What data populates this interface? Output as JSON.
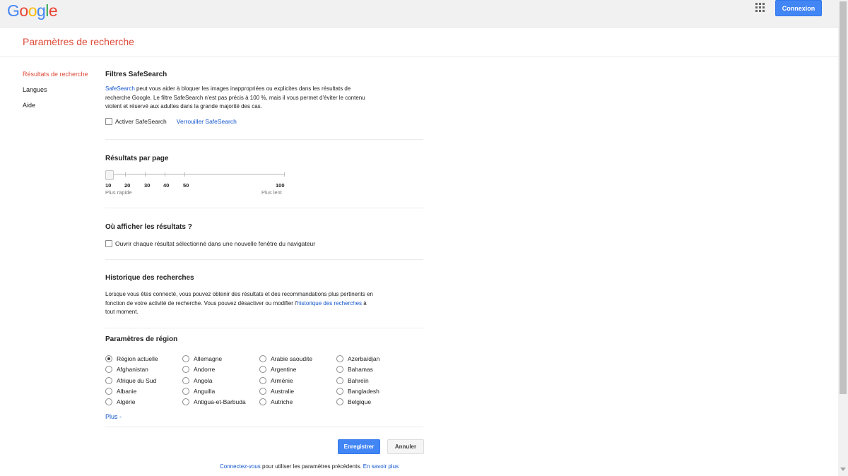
{
  "header": {
    "logo_letters": [
      "G",
      "o",
      "o",
      "g",
      "l",
      "e"
    ],
    "logo_colors": [
      "#4285f4",
      "#ea4335",
      "#fbbc05",
      "#4285f4",
      "#34a853",
      "#ea4335"
    ],
    "signin_label": "Connexion"
  },
  "page": {
    "title": "Paramètres de recherche"
  },
  "sidebar": {
    "items": [
      {
        "label": "Résultats de recherche",
        "active": true
      },
      {
        "label": "Langues",
        "active": false
      },
      {
        "label": "Aide",
        "active": false
      }
    ]
  },
  "safesearch": {
    "title": "Filtres SafeSearch",
    "link_label": "SafeSearch",
    "desc_line1": " peut vous aider à bloquer les images inappropriées ou explicites dans les résultats de",
    "desc_line2": "recherche Google. Le filtre SafeSearch n'est pas précis à 100 %, mais il vous permet d'éviter le contenu",
    "desc_line3": "violent et réservé aux adultes dans la grande majorité des cas.",
    "checkbox_label": "Activer SafeSearch",
    "lock_label": "Verrouiller SafeSearch"
  },
  "results_per_page": {
    "title": "Résultats par page",
    "ticks": [
      "10",
      "20",
      "30",
      "40",
      "50",
      "100"
    ],
    "selected": "10",
    "left_caption": "Plus rapide",
    "right_caption": "Plus lent"
  },
  "open_results": {
    "title": "Où afficher les résultats ?",
    "checkbox_label": "Ouvrir chaque résultat sélectionné dans une nouvelle fenêtre du navigateur"
  },
  "history": {
    "title": "Historique des recherches",
    "line1": "Lorsque vous êtes connecté, vous pouvez obtenir des résultats et des recommandations plus pertinents en",
    "line2_pre": "fonction de votre activité de recherche. Vous pouvez désactiver ou modifier l'",
    "link_label": "historique des recherches",
    "line2_post": " à",
    "line3": "tout moment."
  },
  "region": {
    "title": "Paramètres de région",
    "columns": [
      [
        "Région actuelle",
        "Afghanistan",
        "Afrique du Sud",
        "Albanie",
        "Algérie"
      ],
      [
        "Allemagne",
        "Andorre",
        "Angola",
        "Anguilla",
        "Antigua-et-Barbuda"
      ],
      [
        "Arabie saoudite",
        "Argentine",
        "Arménie",
        "Australie",
        "Autriche"
      ],
      [
        "Azerbaïdjan",
        "Bahamas",
        "Bahreïn",
        "Bangladesh",
        "Belgique"
      ]
    ],
    "selected": "Région actuelle",
    "more_label": "Plus -"
  },
  "actions": {
    "save_label": "Enregistrer",
    "cancel_label": "Annuler"
  },
  "footer": {
    "signin_link": "Connectez-vous",
    "text": " pour utiliser les paramètres précédents. ",
    "learn_more": "En savoir plus"
  }
}
